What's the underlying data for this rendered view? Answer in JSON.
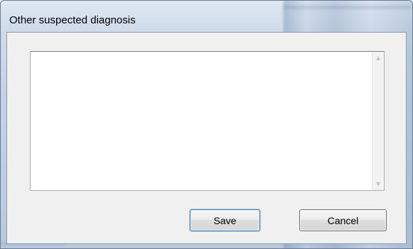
{
  "window": {
    "title": "Other suspected diagnosis"
  },
  "textbox": {
    "value": ""
  },
  "buttons": {
    "save_label": "Save",
    "cancel_label": "Cancel"
  },
  "icons": {
    "scroll_up": "scroll-up-arrow-icon",
    "scroll_down": "scroll-down-arrow-icon"
  },
  "colors": {
    "frame": "#c3d2e4",
    "client": "#f0f0f0",
    "textbox": "#ffffff"
  }
}
